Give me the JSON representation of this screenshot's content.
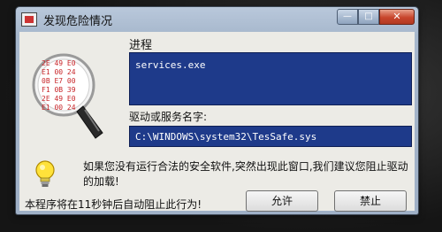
{
  "window": {
    "title": "发现危险情况",
    "minimize_glyph": "—",
    "maximize_glyph": "□",
    "close_glyph": "✕"
  },
  "illustration": {
    "icon": "magnifier-hex-icon",
    "hex_lines": [
      "2E 49 E0",
      "E1 00 24",
      "0B E7 00",
      "F1 0B 39",
      "2E 49 E0",
      "E1 00 24"
    ]
  },
  "process": {
    "label": "进程",
    "value": "services.exe"
  },
  "service": {
    "label": "驱动或服务名字:",
    "value": "C:\\WINDOWS\\system32\\TesSafe.sys"
  },
  "warning": {
    "icon": "lightbulb-icon",
    "message": "如果您没有运行合法的安全软件,突然出现此窗口,我们建议您阻止驱动的加载!"
  },
  "countdown": {
    "text": "本程序将在11秒钟后自动阻止此行为!"
  },
  "buttons": {
    "allow": "允许",
    "block": "禁止"
  },
  "colors": {
    "field_background": "#1e3a8a",
    "titlebar": "#b9c8db",
    "close_button": "#c8452c"
  }
}
